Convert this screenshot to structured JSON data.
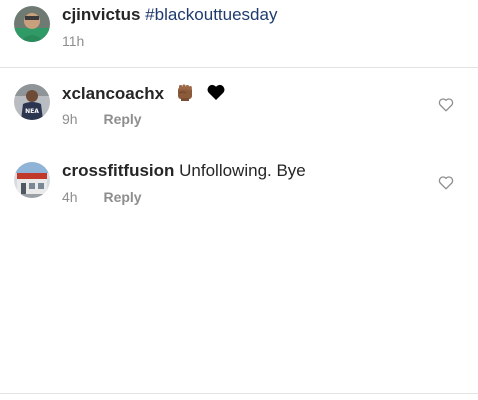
{
  "caption": {
    "username": "cjinvictus",
    "hashtag": "#blackouttuesday",
    "time": "11h"
  },
  "comments": [
    {
      "username": "xclancoachx",
      "text": "",
      "emojis": [
        "raised-fist-icon",
        "black-heart-icon"
      ],
      "time": "9h",
      "reply_label": "Reply",
      "avatar_text": "NEA"
    },
    {
      "username": "crossfitfusion",
      "text": "Unfollowing. Bye",
      "time": "4h",
      "reply_label": "Reply"
    }
  ],
  "colors": {
    "text": "#262626",
    "meta": "#8e8e8e",
    "hashtag": "#1f3b6e",
    "divider": "#e3e3e3"
  }
}
